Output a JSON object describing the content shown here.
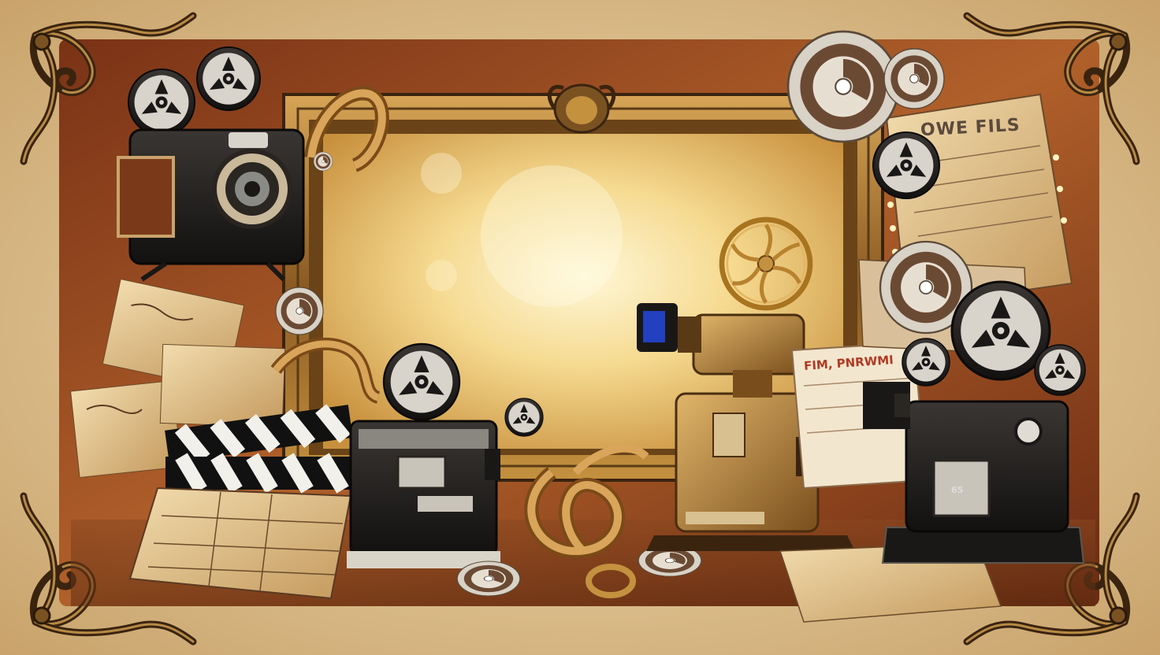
{
  "scene": {
    "poster_heading": "OWE FILS",
    "playbill_heading": "FIM, PNRWMI",
    "projector_counter": "65"
  },
  "colors": {
    "parchment": "#e8d3a6",
    "rust_panel": "#9a4a1f",
    "gold_frame": "#a87a3a",
    "glow_center": "#fff4c8",
    "metal_dark": "#1c1a18",
    "brass": "#b8893e"
  },
  "icons": [
    "vintage-movie-camera",
    "film-reel",
    "clapperboard",
    "film-projector",
    "film-strip",
    "ornament-corner"
  ]
}
